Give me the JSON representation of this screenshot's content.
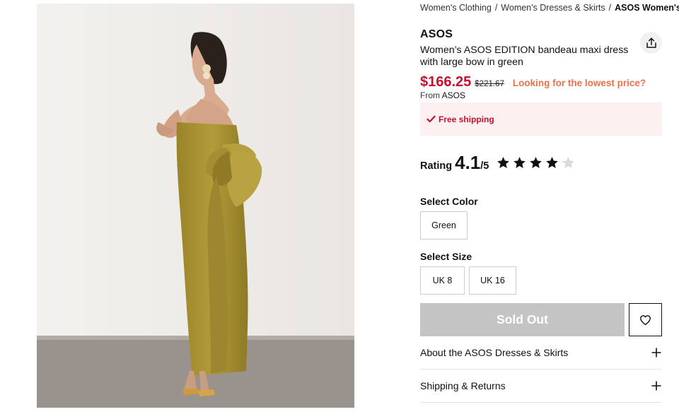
{
  "breadcrumb": [
    {
      "label": "Women's Clothing"
    },
    {
      "label": "Women's Dresses & Skirts"
    },
    {
      "label": "ASOS Women's D"
    }
  ],
  "breadcrumb_separator": "/",
  "product": {
    "brand": "ASOS",
    "title": "Women’s ASOS EDITION bandeau maxi dress with large bow in green",
    "image_icon": "product-photo"
  },
  "price": {
    "current": "$166.25",
    "original": "$221.67",
    "lowest_price_link": "Looking for the lowest price?",
    "from_label": "From",
    "seller": "ASOS"
  },
  "shipping": {
    "text": "Free shipping",
    "icon": "check-icon"
  },
  "rating": {
    "label": "Rating",
    "value": "4.1",
    "out_of": "/5",
    "stars": 4.1,
    "max_stars": 5
  },
  "color": {
    "label": "Select Color",
    "options": [
      "Green"
    ]
  },
  "size": {
    "label": "Select Size",
    "options": [
      "UK 8",
      "UK 16"
    ]
  },
  "actions": {
    "sold_out_label": "Sold Out",
    "wishlist_icon": "heart-icon",
    "share_icon": "share-icon"
  },
  "accordions": [
    {
      "label": "About the ASOS Dresses & Skirts"
    },
    {
      "label": "Shipping & Returns"
    }
  ],
  "colors": {
    "price_red": "#c8102e",
    "link_orange": "#e8724a",
    "banner_bg": "#fcf0f1",
    "sold_out_bg": "#c4c4c4",
    "dress": "#a99232"
  }
}
